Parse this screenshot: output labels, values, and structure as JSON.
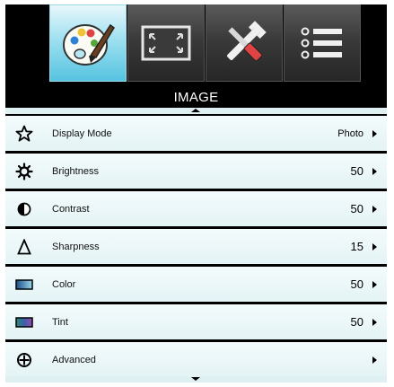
{
  "tabs": [
    {
      "name": "image",
      "icon": "palette-icon",
      "active": true
    },
    {
      "name": "display",
      "icon": "screen-resize-icon",
      "active": false
    },
    {
      "name": "setup",
      "icon": "tools-icon",
      "active": false
    },
    {
      "name": "options",
      "icon": "list-icon",
      "active": false
    }
  ],
  "title": "IMAGE",
  "menu": {
    "items": [
      {
        "label": "Display Mode",
        "value": "Photo",
        "icon": "star-icon"
      },
      {
        "label": "Brightness",
        "value": "50",
        "icon": "brightness-icon"
      },
      {
        "label": "Contrast",
        "value": "50",
        "icon": "contrast-icon"
      },
      {
        "label": "Sharpness",
        "value": "15",
        "icon": "sharpness-icon"
      },
      {
        "label": "Color",
        "value": "50",
        "icon": "color-icon"
      },
      {
        "label": "Tint",
        "value": "50",
        "icon": "tint-icon"
      },
      {
        "label": "Advanced",
        "value": "",
        "icon": "advanced-icon"
      }
    ]
  },
  "colors": {
    "active_tab": "#55c3e0",
    "row_bg": "#e4f3f5",
    "osd_bg": "#000000"
  }
}
